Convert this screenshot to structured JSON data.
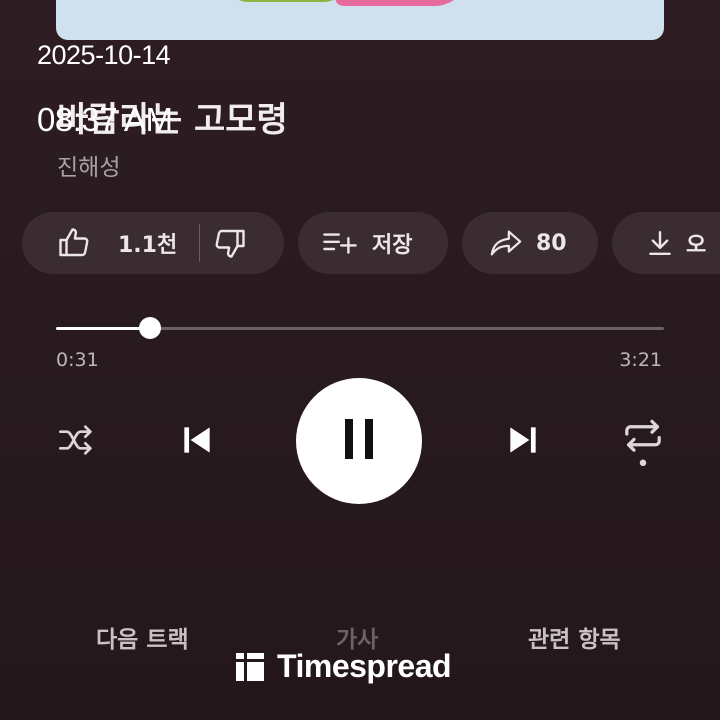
{
  "status": {
    "date": "2025-10-14",
    "time": "08:37 AM"
  },
  "song": {
    "title": "바람라는 고모령",
    "artist": "진해성"
  },
  "actions": {
    "like_count": "1.1천",
    "save_label": "저장",
    "share_count": "80",
    "download_label": "오"
  },
  "progress": {
    "elapsed": "0:31",
    "total": "3:21",
    "fraction": 0.154
  },
  "tabs": {
    "up_next": "다음 트랙",
    "lyrics": "가사",
    "related": "관련 항목"
  },
  "watermark": {
    "text": "Timespread"
  },
  "icons": [
    "thumbs-up-icon",
    "thumbs-down-icon",
    "playlist-add-icon",
    "share-icon",
    "download-icon",
    "shuffle-icon",
    "skip-previous-icon",
    "pause-icon",
    "skip-next-icon",
    "repeat-icon"
  ],
  "colors": {
    "background": "#2a1b20",
    "pill": "#3a2c31",
    "accent": "#ffffff"
  }
}
